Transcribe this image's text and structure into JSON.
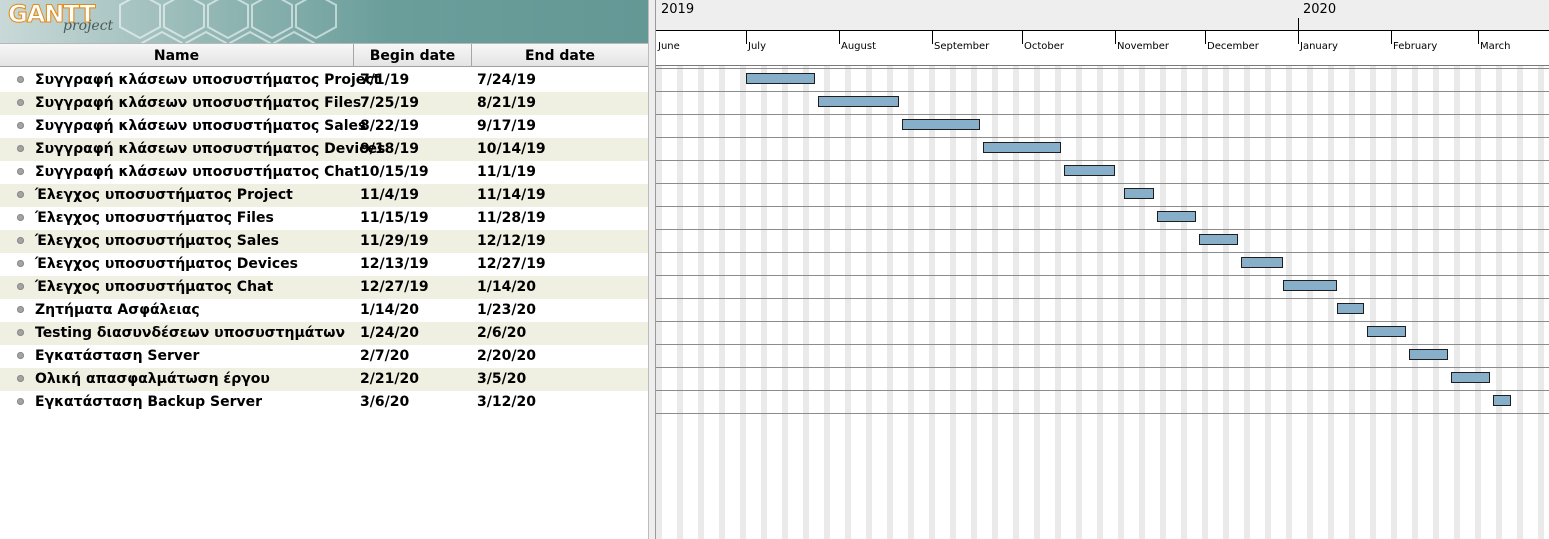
{
  "app": {
    "logo_text": "GANTT",
    "logo_sub": "project"
  },
  "table": {
    "columns": {
      "name": "Name",
      "begin": "Begin date",
      "end": "End date"
    },
    "tasks": [
      {
        "name": "Συγγραφή κλάσεων υποσυστήματος Project",
        "begin": "7/1/19",
        "end": "7/24/19"
      },
      {
        "name": "Συγγραφή κλάσεων υποσυστήματος Files",
        "begin": "7/25/19",
        "end": "8/21/19"
      },
      {
        "name": "Συγγραφή κλάσεων υποσυστήματος Sales",
        "begin": "8/22/19",
        "end": "9/17/19"
      },
      {
        "name": "Συγγραφή κλάσεων υποσυστήματος Devices",
        "begin": "9/18/19",
        "end": "10/14/19"
      },
      {
        "name": "Συγγραφή κλάσεων υποσυστήματος Chat",
        "begin": "10/15/19",
        "end": "11/1/19"
      },
      {
        "name": "Έλεγχος υποσυστήματος Project",
        "begin": "11/4/19",
        "end": "11/14/19"
      },
      {
        "name": "Έλεγχος υποσυστήματος Files",
        "begin": "11/15/19",
        "end": "11/28/19"
      },
      {
        "name": "Έλεγχος υποσυστήματος Sales",
        "begin": "11/29/19",
        "end": "12/12/19"
      },
      {
        "name": "Έλεγχος υποσυστήματος Devices",
        "begin": "12/13/19",
        "end": "12/27/19"
      },
      {
        "name": "Έλεγχος υποσυστήματος Chat",
        "begin": "12/27/19",
        "end": "1/14/20"
      },
      {
        "name": "Ζητήματα Ασφάλειας",
        "begin": "1/14/20",
        "end": "1/23/20"
      },
      {
        "name": "Testing διασυνδέσεων υποσυστημάτων",
        "begin": "1/24/20",
        "end": "2/6/20"
      },
      {
        "name": "Εγκατάσταση Server",
        "begin": "2/7/20",
        "end": "2/20/20"
      },
      {
        "name": "Ολική απασφαλμάτωση έργου",
        "begin": "2/21/20",
        "end": "3/5/20"
      },
      {
        "name": "Εγκατάσταση Backup Server",
        "begin": "3/6/20",
        "end": "3/12/20"
      }
    ]
  },
  "timeline": {
    "years": [
      {
        "label": "2019",
        "start": "2019-06-01"
      },
      {
        "label": "2020",
        "start": "2020-01-01"
      }
    ],
    "months": [
      {
        "label": "June",
        "start": "2019-06-01"
      },
      {
        "label": "July",
        "start": "2019-07-01"
      },
      {
        "label": "August",
        "start": "2019-08-01"
      },
      {
        "label": "September",
        "start": "2019-09-01"
      },
      {
        "label": "October",
        "start": "2019-10-01"
      },
      {
        "label": "November",
        "start": "2019-11-01"
      },
      {
        "label": "December",
        "start": "2019-12-01"
      },
      {
        "label": "January",
        "start": "2020-01-01"
      },
      {
        "label": "February",
        "start": "2020-02-01"
      },
      {
        "label": "March",
        "start": "2020-03-01"
      }
    ]
  },
  "colors": {
    "task_bar": "#87afca",
    "alt_row": "#efefe2",
    "weekend": "#eaeaea"
  }
}
